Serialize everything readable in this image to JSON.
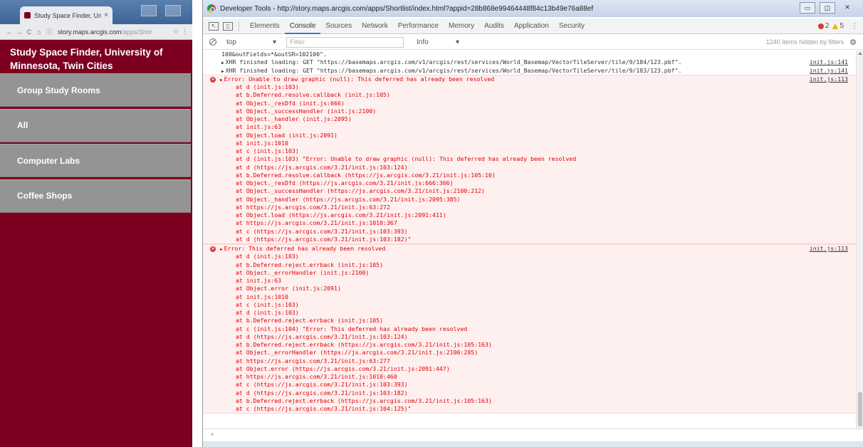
{
  "browser": {
    "tab_title": "Study Space Finder, Univ",
    "tab_close": "×",
    "url_host": "story.maps.arcgis.com",
    "url_path": "/apps/Shor",
    "app_title": "Study Space Finder, University of Minnesota, Twin Cities",
    "menu": [
      {
        "label": "Group Study Rooms"
      },
      {
        "label": "All"
      },
      {
        "label": "Computer Labs"
      },
      {
        "label": "Coffee Shops"
      }
    ],
    "colors": {
      "brand": "#7d0020",
      "menu": "#949494"
    }
  },
  "devtools": {
    "title": "Developer Tools - http://story.maps.arcgis.com/apps/Shortlist/index.html?appid=28b868e99464448f84c13b49e76a88ef",
    "tabs": [
      "Elements",
      "Console",
      "Sources",
      "Network",
      "Performance",
      "Memory",
      "Audits",
      "Application",
      "Security"
    ],
    "active_tab": "Console",
    "error_count": "2",
    "warning_count": "5",
    "context": "top",
    "filter_placeholder": "Filter",
    "level": "Info",
    "hidden_note": "1240 items hidden by filters",
    "log_lines": [
      {
        "text": "100&outFields=*&outSR=102100\".",
        "source": ""
      },
      {
        "text": "XHR finished loading: GET \"https://basemaps.arcgis.com/v1/arcgis/rest/services/World_Basemap/VectorTileServer/tile/9/184/123.pbf\".",
        "source": "init.js:141"
      },
      {
        "text": "XHR finished loading: GET \"https://basemaps.arcgis.com/v1/arcgis/rest/services/World_Basemap/VectorTileServer/tile/9/183/123.pbf\".",
        "source": "init.js:141"
      }
    ],
    "errors": [
      {
        "message": "Error: Unable to draw graphic (null): This deferred has already been resolved",
        "source": "init.js:113",
        "frames": [
          "at d (init.js:103)",
          "at b.Deferred.resolve.callback (init.js:105)",
          "at Object._resDfd (init.js:666)",
          "at Object._successHandler (init.js:2100)",
          "at Object._handler (init.js:2095)",
          "at init.js:63",
          "at Object.load (init.js:2091)",
          "at init.js:1010",
          "at c (init.js:103)",
          "at d (init.js:103) \"Error: Unable to draw graphic (null): This deferred has already been resolved",
          "at d (https://js.arcgis.com/3.21/init.js:103:124)",
          "at b.Deferred.resolve.callback (https://js.arcgis.com/3.21/init.js:105:10)",
          "at Object._resDfd (https://js.arcgis.com/3.21/init.js:666:366)",
          "at Object._successHandler (https://js.arcgis.com/3.21/init.js:2100:212)",
          "at Object._handler (https://js.arcgis.com/3.21/init.js:2095:385)",
          "at https://js.arcgis.com/3.21/init.js:63:272",
          "at Object.load (https://js.arcgis.com/3.21/init.js:2091:411)",
          "at https://js.arcgis.com/3.21/init.js:1010:367",
          "at c (https://js.arcgis.com/3.21/init.js:103:393)",
          "at d (https://js.arcgis.com/3.21/init.js:103:182)\""
        ]
      },
      {
        "message": "Error: This deferred has already been resolved",
        "source": "init.js:113",
        "frames": [
          "at d (init.js:103)",
          "at b.Deferred.reject.errback (init.js:105)",
          "at Object._errorHandler (init.js:2100)",
          "at init.js:63",
          "at Object.error (init.js:2091)",
          "at init.js:1010",
          "at c (init.js:103)",
          "at d (init.js:103)",
          "at b.Deferred.reject.errback (init.js:105)",
          "at c (init.js:104) \"Error: This deferred has already been resolved",
          "at d (https://js.arcgis.com/3.21/init.js:103:124)",
          "at b.Deferred.reject.errback (https://js.arcgis.com/3.21/init.js:105:163)",
          "at Object._errorHandler (https://js.arcgis.com/3.21/init.js:2100:285)",
          "at https://js.arcgis.com/3.21/init.js:63:277",
          "at Object.error (https://js.arcgis.com/3.21/init.js:2091:447)",
          "at https://js.arcgis.com/3.21/init.js:1010:460",
          "at c (https://js.arcgis.com/3.21/init.js:103:393)",
          "at d (https://js.arcgis.com/3.21/init.js:103:182)",
          "at b.Deferred.reject.errback (https://js.arcgis.com/3.21/init.js:105:163)",
          "at c (https://js.arcgis.com/3.21/init.js:104:125)\""
        ]
      }
    ],
    "prompt_symbol": "›",
    "colors": {
      "error": "#d83a3a",
      "warning": "#f0b400",
      "accent": "#3879d9"
    }
  }
}
